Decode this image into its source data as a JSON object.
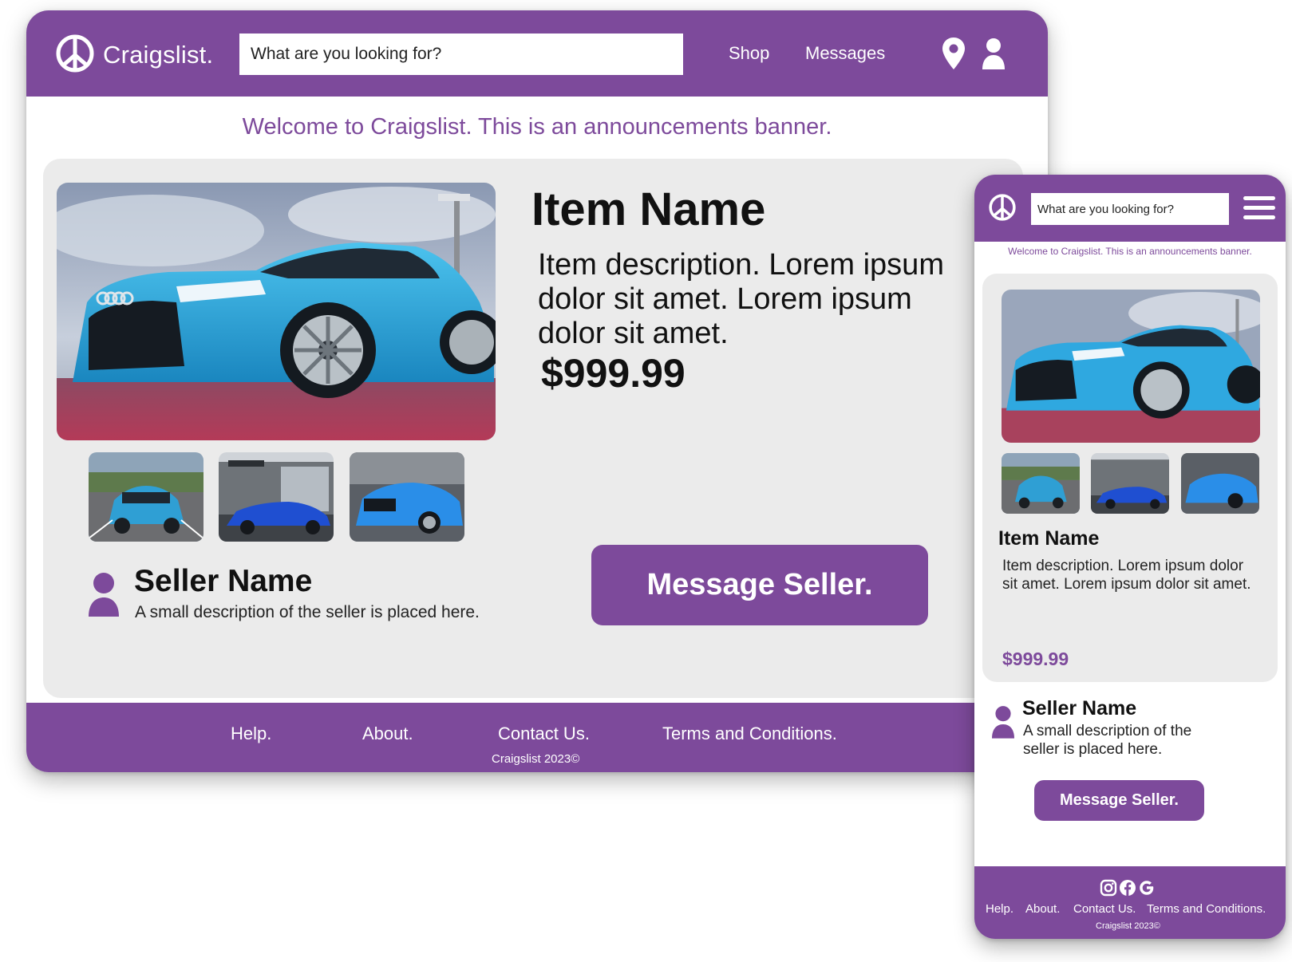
{
  "brand": {
    "name": "Craigslist."
  },
  "colors": {
    "accent": "#7d4a9b",
    "card_bg": "#ebebeb",
    "car_blue": "#2f9fd4"
  },
  "search": {
    "placeholder": "What are you looking for?"
  },
  "nav": {
    "shop": "Shop",
    "messages": "Messages"
  },
  "icons": [
    "peace-logo-icon",
    "location-pin-icon",
    "user-icon",
    "hamburger-menu-icon",
    "instagram-icon",
    "facebook-icon",
    "google-icon",
    "seller-avatar-icon"
  ],
  "banner": {
    "text": "Welcome to Craigslist. This is an announcements banner."
  },
  "item": {
    "name": "Item Name",
    "description": "Item description. Lorem ipsum dolor sit amet. Lorem ipsum dolor sit amet.",
    "price": "$999.99"
  },
  "seller": {
    "name": "Seller Name",
    "description": "A small description of the seller is placed here.",
    "button": "Message Seller."
  },
  "footer": {
    "links": [
      "Help.",
      "About.",
      "Contact Us.",
      "Terms and Conditions."
    ],
    "copyright": "Craigslist 2023©"
  }
}
